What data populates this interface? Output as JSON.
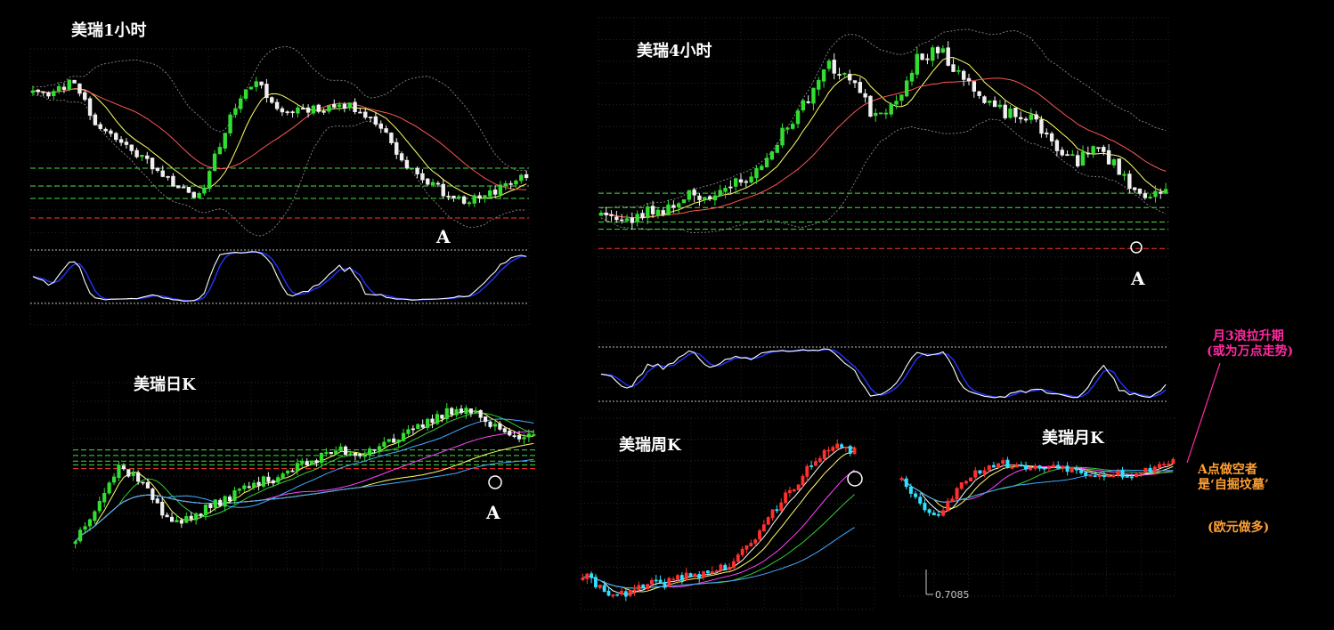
{
  "colors": {
    "background": "#000000",
    "bull": "#33dd33",
    "bear": "#f0f0f0",
    "bull_weekly": "#ff3030",
    "bear_weekly": "#33e0ff",
    "ma_fast": "#ffff66",
    "ma_mid": "#ff5555",
    "ma_slow": "#44aaff",
    "ma_purple": "#ff44ff",
    "ma_green": "#33cc33",
    "bollinger": "#888888",
    "support_green": "#44dd44",
    "support_red": "#ff3333",
    "stoch_k": "#ffffff",
    "stoch_d": "#2233ff",
    "annotation_pink": "#ff2aa0",
    "annotation_orange": "#ffa033"
  },
  "chart_data": [
    {
      "id": "h1",
      "type": "candlestick",
      "title": "美瑞1小时",
      "marker_label": "A",
      "seed": 11,
      "count": 96,
      "path": [
        1.32,
        1.315,
        1.33,
        1.285,
        1.27,
        1.255,
        1.24,
        1.222,
        1.205,
        1.26,
        1.31,
        1.325,
        1.295,
        1.3,
        1.3,
        1.303,
        1.298,
        1.28,
        1.245,
        1.23,
        1.215,
        1.205,
        1.21,
        1.225,
        1.23
      ],
      "ylim": [
        1.18,
        1.36
      ]
    },
    {
      "id": "h4",
      "type": "candlestick",
      "title": "美瑞4小时",
      "marker_label": "A",
      "seed": 23,
      "count": 110,
      "path": [
        1.26,
        1.245,
        1.258,
        1.262,
        1.28,
        1.27,
        1.29,
        1.3,
        1.34,
        1.37,
        1.41,
        1.4,
        1.36,
        1.37,
        1.42,
        1.425,
        1.4,
        1.37,
        1.36,
        1.355,
        1.33,
        1.31,
        1.325,
        1.3,
        1.27,
        1.285
      ],
      "ylim": [
        1.21,
        1.46
      ]
    },
    {
      "id": "d1",
      "type": "candlestick",
      "title": "美瑞日K",
      "marker_label": "A",
      "seed": 37,
      "count": 96,
      "path": [
        1.1,
        1.16,
        1.22,
        1.2,
        1.14,
        1.13,
        1.15,
        1.17,
        1.19,
        1.2,
        1.22,
        1.23,
        1.25,
        1.24,
        1.26,
        1.27,
        1.29,
        1.31,
        1.32,
        1.29,
        1.27,
        1.28
      ],
      "ylim": [
        1.05,
        1.36
      ]
    },
    {
      "id": "w1",
      "type": "candlestick",
      "title": "美瑞周K",
      "seed": 41,
      "count": 64,
      "path": [
        0.9,
        0.86,
        0.84,
        0.87,
        0.88,
        0.9,
        0.91,
        0.93,
        0.99,
        1.08,
        1.16,
        1.23,
        1.28,
        1.27
      ],
      "ylim": [
        0.8,
        1.34
      ]
    },
    {
      "id": "m1",
      "type": "candlestick",
      "title": "美瑞月K",
      "seed": 53,
      "count": 60,
      "path": [
        1.15,
        1.0,
        0.95,
        1.12,
        1.18,
        1.22,
        1.2,
        1.19,
        1.21,
        1.18,
        1.16,
        1.17,
        1.15,
        1.2,
        1.23
      ],
      "ylim": [
        0.68,
        1.4
      ],
      "low_label": "0.7085"
    }
  ],
  "annotations": {
    "monthly_wave_line1": "月3浪拉升期",
    "monthly_wave_line2": "(或为万点走势)",
    "a_shorts_line1": "A点做空者",
    "a_shorts_line2": "是‘自掘坟墓’",
    "euro_long": "(欧元做多)"
  }
}
